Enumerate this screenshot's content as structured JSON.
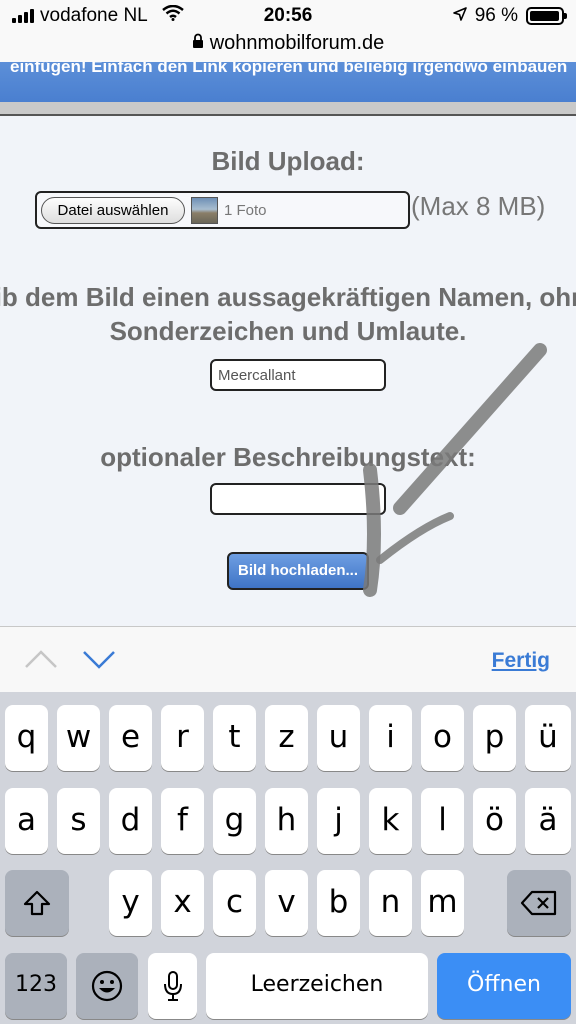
{
  "status_bar": {
    "carrier": "vodafone NL",
    "time": "20:56",
    "battery_percent": "96 %",
    "battery_level": 0.96
  },
  "url_bar": {
    "domain": "wohnmobilforum.de"
  },
  "banner": {
    "text": "einfügen! Einfach den Link kopieren und beliebig irgendwo einbauen"
  },
  "form": {
    "title": "Bild Upload:",
    "file_button_label": "Datei auswählen",
    "file_count": "1 Foto",
    "max_size": "(Max 8 MB)",
    "name_instruction_line1": "Gib dem Bild einen aussagekräftigen Namen, ohne",
    "name_instruction_line2": "Sonderzeichen und Umlaute.",
    "name_value": "Meercallant",
    "description_label": "optionaler Beschreibungstext:",
    "description_value": "",
    "upload_button_label": "Bild hochladen..."
  },
  "accessory_bar": {
    "done_label": "Fertig"
  },
  "keyboard": {
    "row1": [
      "q",
      "w",
      "e",
      "r",
      "t",
      "z",
      "u",
      "i",
      "o",
      "p",
      "ü"
    ],
    "row2": [
      "a",
      "s",
      "d",
      "f",
      "g",
      "h",
      "j",
      "k",
      "l",
      "ö",
      "ä"
    ],
    "row3": [
      "y",
      "x",
      "c",
      "v",
      "b",
      "n",
      "m"
    ],
    "numbers_label": "123",
    "space_label": "Leerzeichen",
    "return_label": "Öffnen"
  },
  "colors": {
    "banner_blue": "#4a7fd0",
    "upload_button_blue": "#3f74c6",
    "done_link": "#3a7bd5",
    "return_key": "#3b8ef5"
  }
}
